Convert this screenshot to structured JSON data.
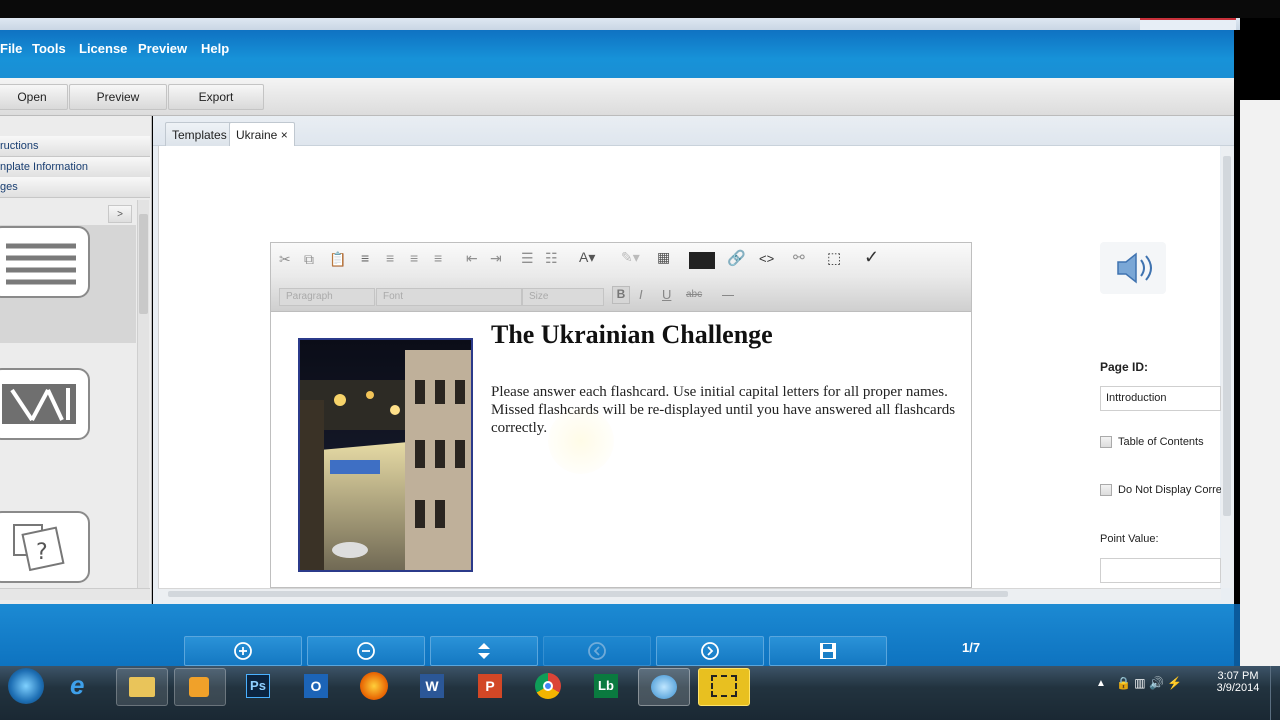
{
  "menu": [
    "File",
    "Tools",
    "License",
    "Preview",
    "Help"
  ],
  "toolbar": {
    "open": "Open",
    "preview": "Preview",
    "export": "Export"
  },
  "left": {
    "sections": [
      "ructions",
      "nplate Information",
      "ges"
    ],
    "expand": ">"
  },
  "tabs": {
    "templates": "Templates",
    "ukraine": "Ukraine",
    "close": "×"
  },
  "editor": {
    "title": "The Ukrainian Challenge",
    "body": "Please answer each flashcard.  Use initial capital letters for all proper names.  Missed flashcards will be re-displayed until you have answered all flashcards correctly.",
    "checkmark": "✓",
    "code": "<>",
    "format_placeholder": "Paragraph",
    "font_placeholder": "Font",
    "size_placeholder": "Size",
    "bold": "B",
    "italic": "I",
    "underline": "U",
    "strike": "abc"
  },
  "properties": {
    "page_id_label": "Page ID:",
    "page_id_value": "Inttroduction",
    "toc_label": "Table of Contents",
    "do_not_display_label": "Do Not Display Corre",
    "point_value_label": "Point Value:"
  },
  "bottom": {
    "page_indicator": "1/7"
  },
  "clock": {
    "time": "3:07 PM",
    "date": "3/9/2014"
  },
  "colors": {
    "brand_blue": "#1792d8",
    "menu_text": "#ffffff"
  }
}
